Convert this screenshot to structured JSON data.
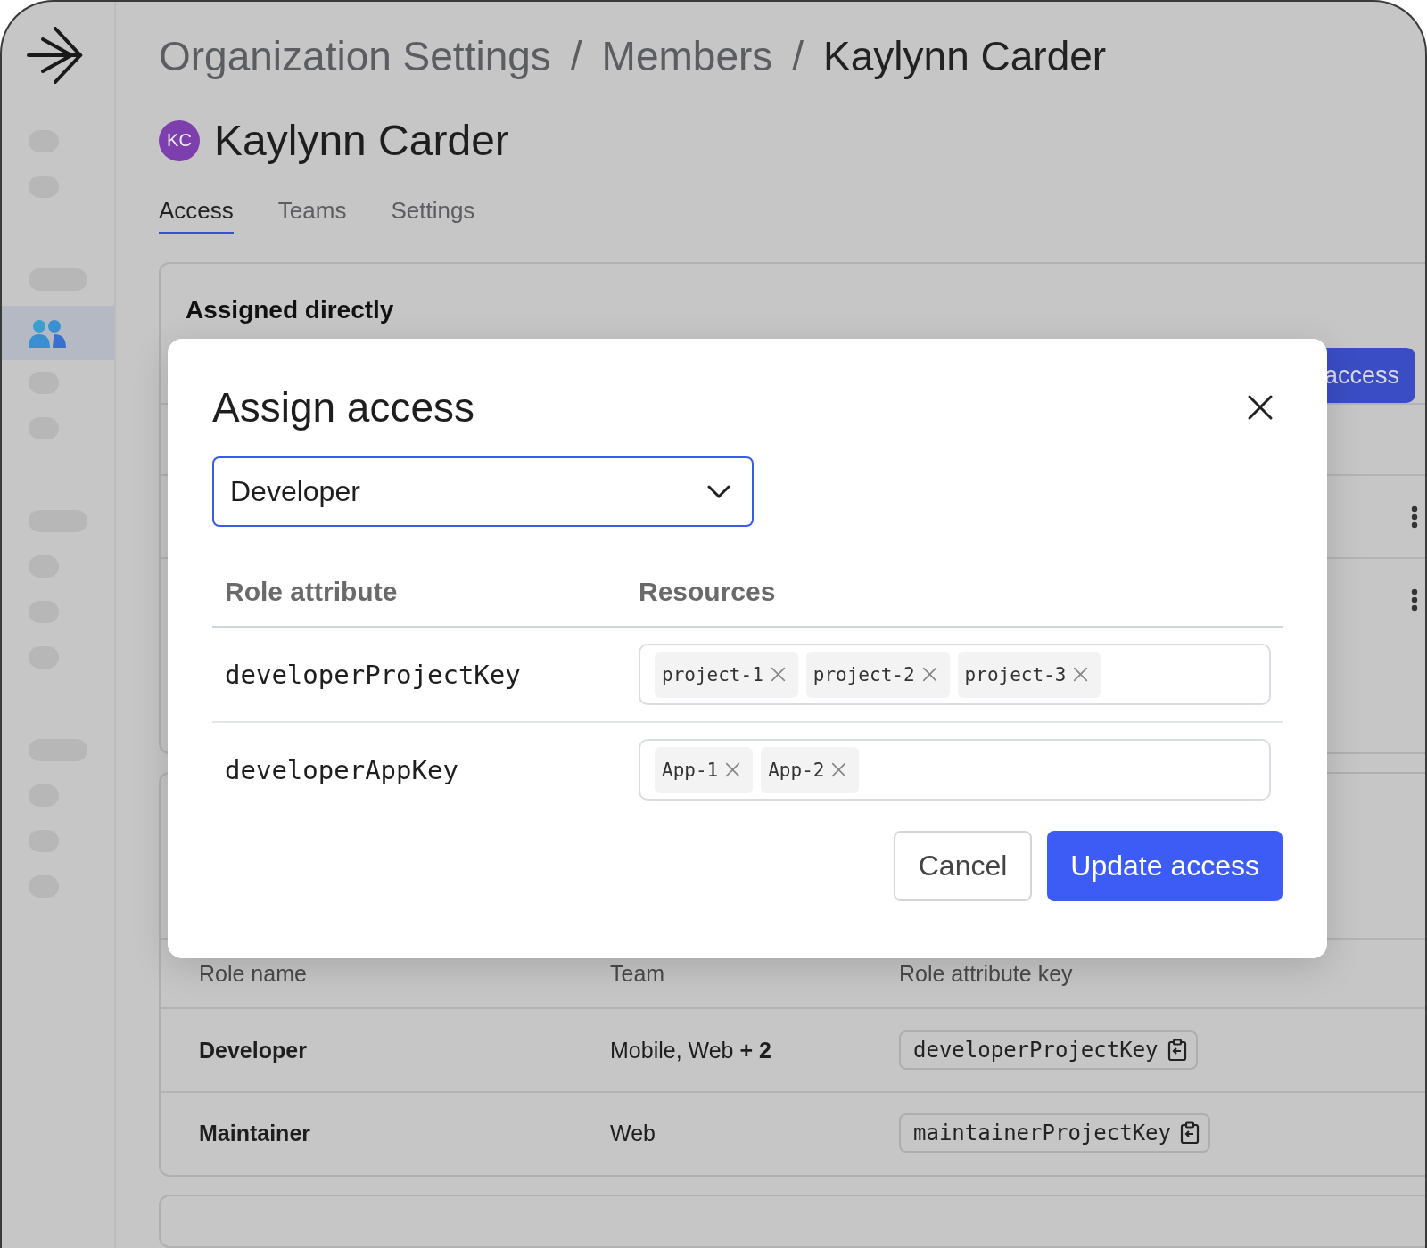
{
  "sidebar": {
    "items": [
      {
        "kind": "short",
        "selected": false
      },
      {
        "kind": "short",
        "selected": false
      },
      {
        "kind": "wide",
        "selected": false
      },
      {
        "kind": "people",
        "selected": true
      },
      {
        "kind": "short",
        "selected": false
      },
      {
        "kind": "short",
        "selected": false
      },
      {
        "kind": "wide",
        "selected": false
      },
      {
        "kind": "short",
        "selected": false
      },
      {
        "kind": "short",
        "selected": false
      },
      {
        "kind": "short",
        "selected": false
      },
      {
        "kind": "wide",
        "selected": false
      },
      {
        "kind": "short",
        "selected": false
      },
      {
        "kind": "short",
        "selected": false
      },
      {
        "kind": "short",
        "selected": false
      }
    ]
  },
  "breadcrumb": {
    "separator": "/",
    "items": [
      {
        "label": "Organization Settings",
        "current": false
      },
      {
        "label": "Members",
        "current": false
      },
      {
        "label": "Kaylynn Carder",
        "current": true
      }
    ]
  },
  "member": {
    "initials": "KC",
    "name": "Kaylynn Carder"
  },
  "tabs": [
    {
      "label": "Access",
      "selected": true
    },
    {
      "label": "Teams",
      "selected": false
    },
    {
      "label": "Settings",
      "selected": false
    }
  ],
  "direct_card": {
    "title": "Assigned directly",
    "button": "access",
    "rows": [
      {
        "actions_menu": true
      },
      {
        "actions_menu": true
      }
    ]
  },
  "teams_table": {
    "columns": [
      "Role name",
      "Team",
      "Role attribute key"
    ],
    "rows": [
      {
        "role": "Developer",
        "team": "Mobile, Web **+ 2**",
        "key": "developerProjectKey"
      },
      {
        "role": "Maintainer",
        "team": "Web",
        "key": "maintainerProjectKey"
      }
    ]
  },
  "dialog": {
    "title": "Assign access",
    "select": {
      "value": "Developer"
    },
    "columns": [
      "Role attribute",
      "Resources"
    ],
    "rows": [
      {
        "attribute": "developerProjectKey",
        "resources": [
          "project-1",
          "project-2",
          "project-3"
        ]
      },
      {
        "attribute": "developerAppKey",
        "resources": [
          "App-1",
          "App-2"
        ]
      }
    ],
    "buttons": [
      {
        "label": "Cancel",
        "kind": "secondary"
      },
      {
        "label": "Update access",
        "kind": "primary"
      }
    ]
  }
}
